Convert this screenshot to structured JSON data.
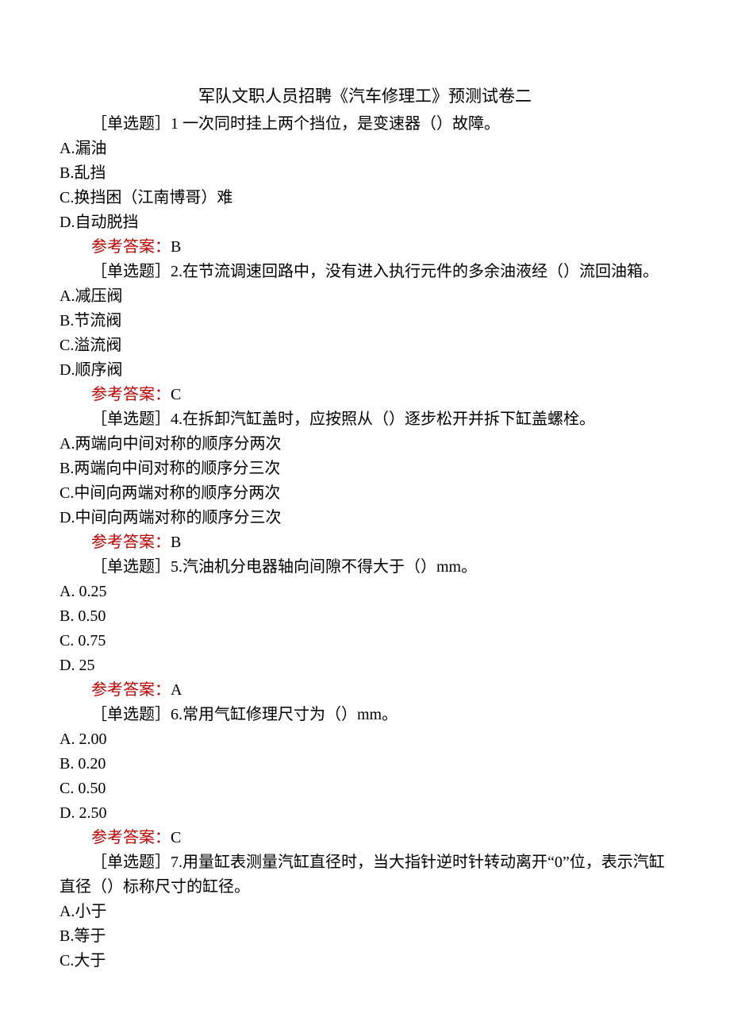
{
  "title": "军队文职人员招聘《汽车修理工》预测试卷二",
  "answerLabel": "参考答案：",
  "questions": [
    {
      "stem": "［单选题］1 一次同时挂上两个挡位，是变速器（）故障。",
      "options": [
        "A.漏油",
        "B.乱挡",
        "C.换挡困（江南博哥）难",
        "D.自动脱挡"
      ],
      "answer": "B"
    },
    {
      "stem": "［单选题］2.在节流调速回路中，没有进入执行元件的多余油液经（）流回油箱。",
      "options": [
        "A.减压阀",
        "B.节流阀",
        "C.溢流阀",
        "D.顺序阀"
      ],
      "answer": "C"
    },
    {
      "stem": "［单选题］4.在拆卸汽缸盖时，应按照从（）逐步松开并拆下缸盖螺栓。",
      "options": [
        "A.两端向中间对称的顺序分两次",
        "B.两端向中间对称的顺序分三次",
        "C.中间向两端对称的顺序分两次",
        "D.中间向两端对称的顺序分三次"
      ],
      "answer": "B"
    },
    {
      "stem": "［单选题］5.汽油机分电器轴向间隙不得大于（）mm。",
      "options": [
        "A. 0.25",
        "B. 0.50",
        "C. 0.75",
        "D. 25"
      ],
      "answer": "A"
    },
    {
      "stem": "［单选题］6.常用气缸修理尺寸为（）mm。",
      "options": [
        "A. 2.00",
        "B. 0.20",
        "C. 0.50",
        "D. 2.50"
      ],
      "answer": "C"
    },
    {
      "stem": "［单选题］7.用量缸表测量汽缸直径时，当大指针逆时针转动离开“0”位，表示汽缸直径（）标称尺寸的缸径。",
      "options": [
        "A.小于",
        "B.等于",
        "C.大于"
      ],
      "answer": null
    }
  ]
}
